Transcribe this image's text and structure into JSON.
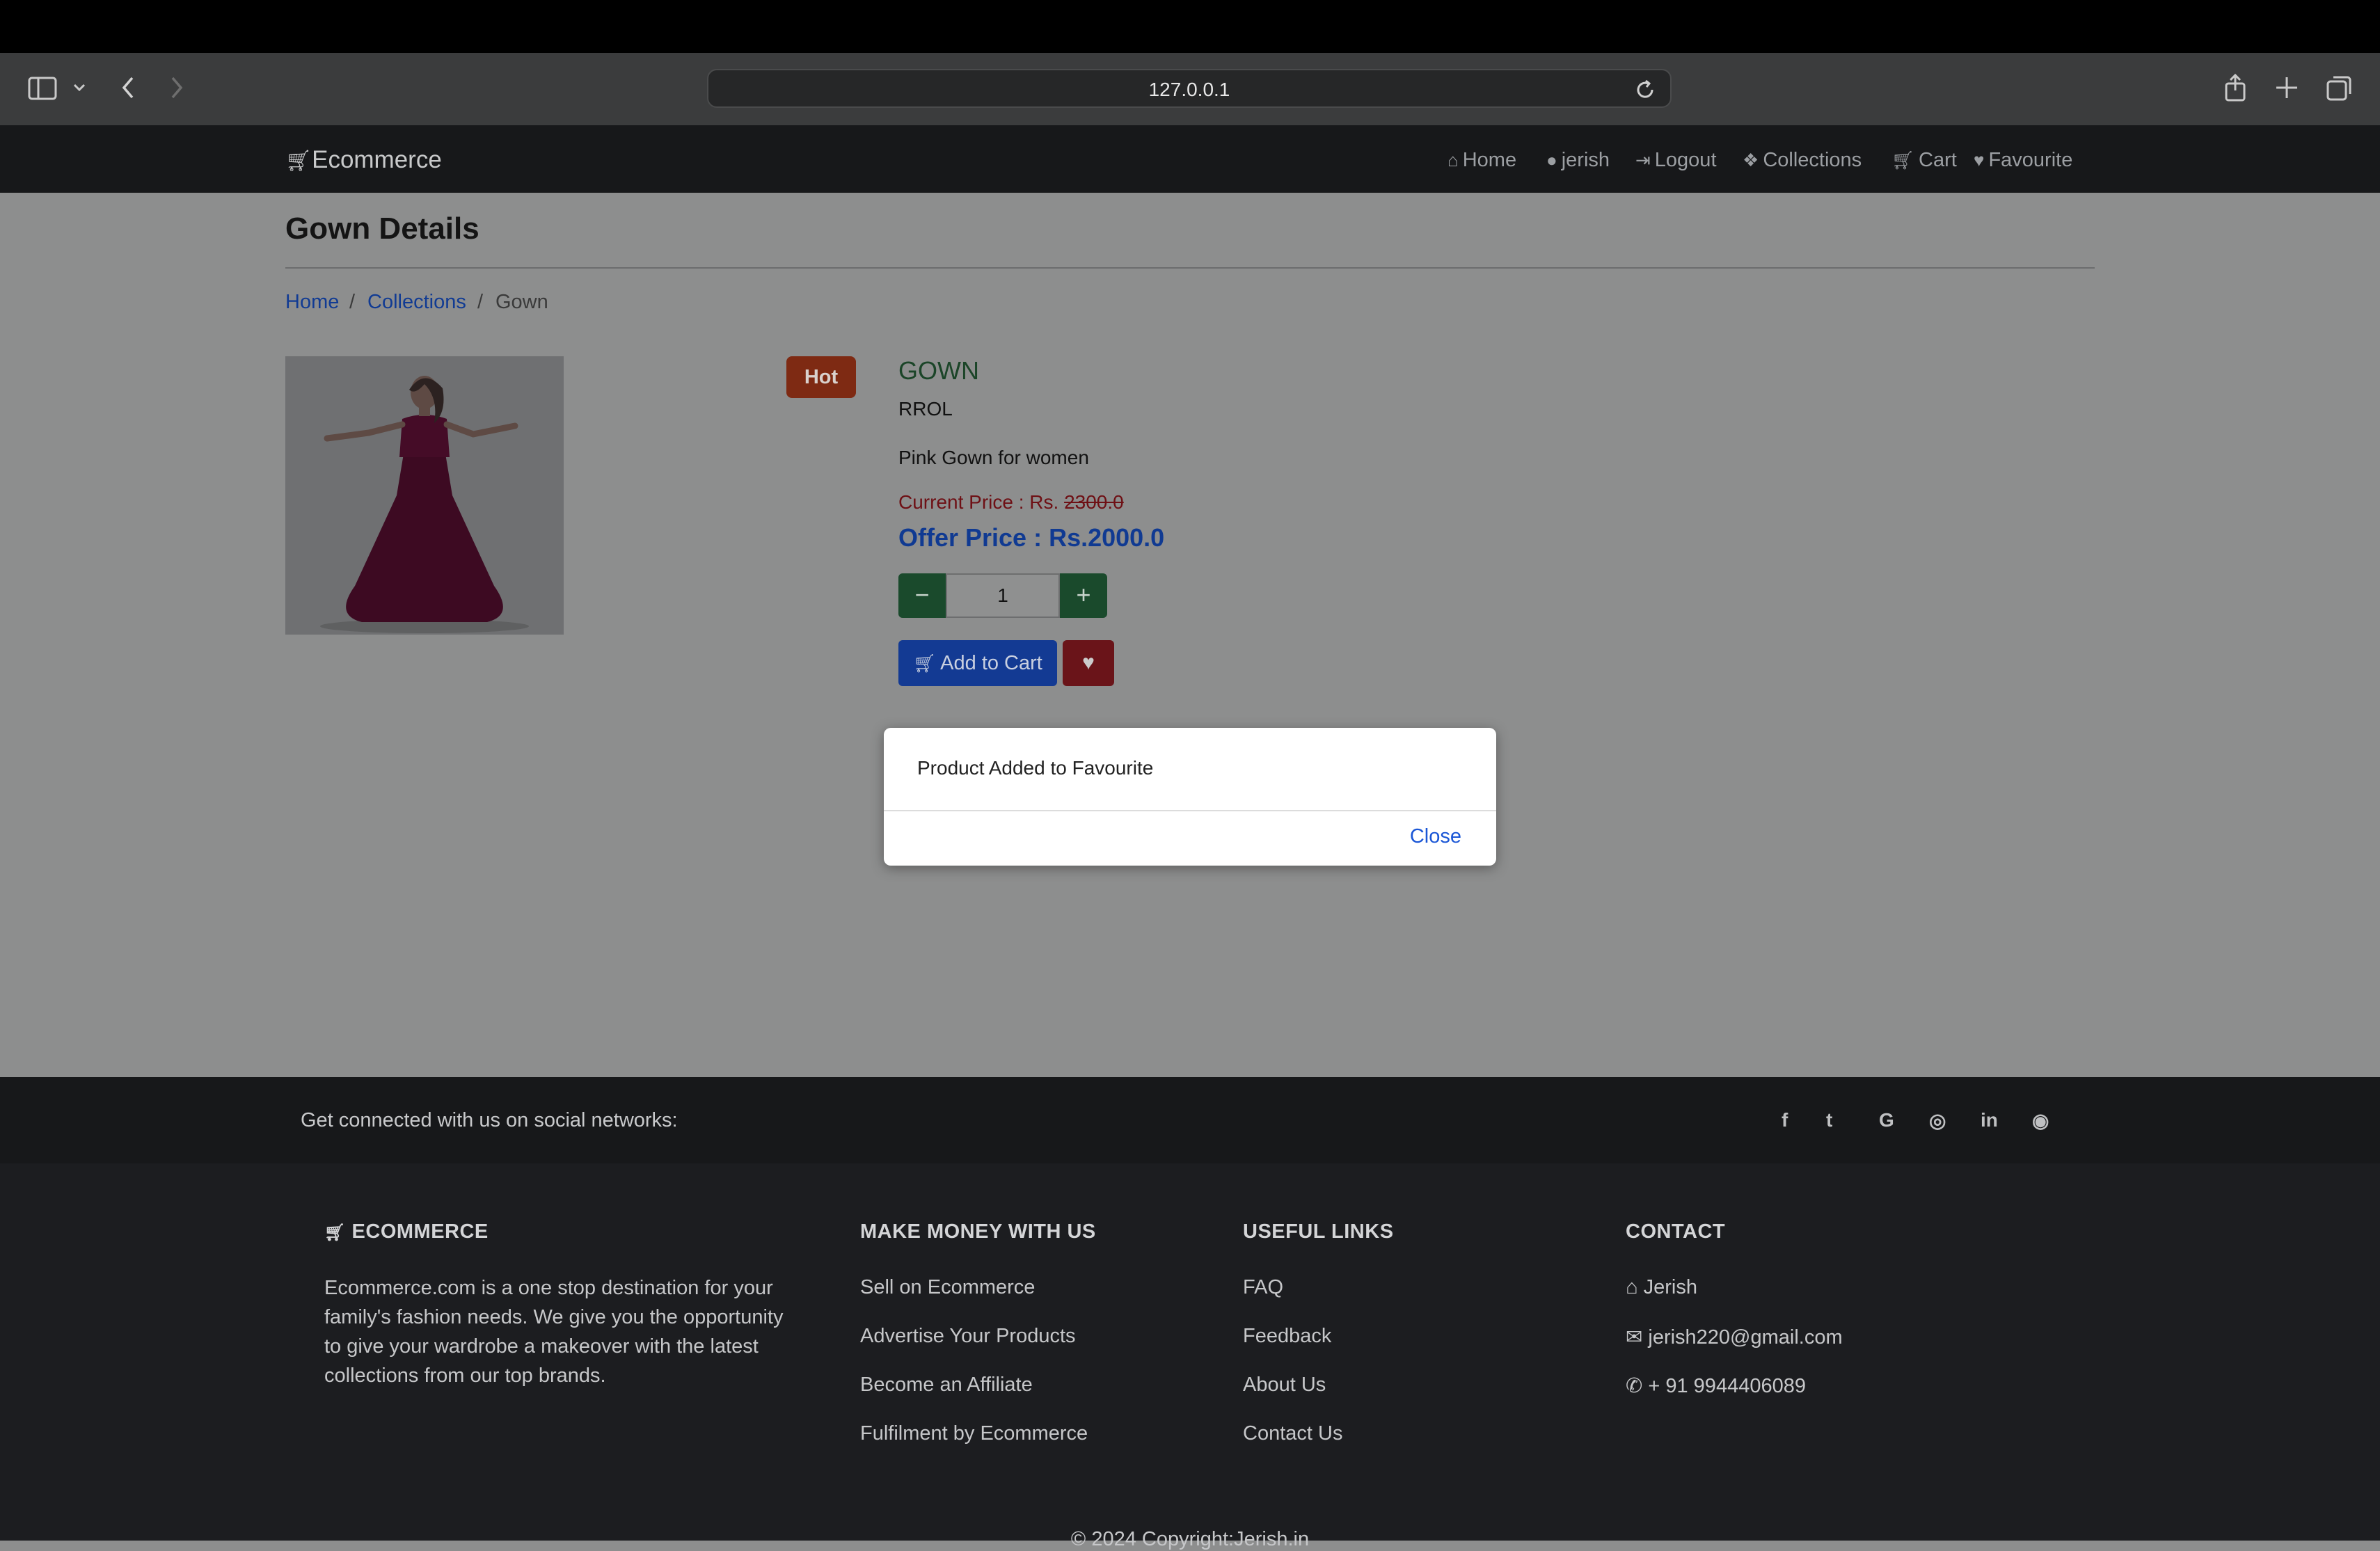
{
  "browser": {
    "url": "127.0.0.1",
    "icons": [
      "sidebar-icon",
      "chevron-down-icon",
      "back-icon",
      "forward-icon",
      "reload-icon",
      "share-icon",
      "new-tab-icon",
      "tabs-overview-icon"
    ]
  },
  "nav": {
    "brand": "Ecommerce",
    "items": [
      {
        "label": "Home",
        "icon": "home-icon"
      },
      {
        "label": "jerish",
        "icon": "user-icon"
      },
      {
        "label": "Logout",
        "icon": "logout-icon"
      },
      {
        "label": "Collections",
        "icon": "cubes-icon"
      },
      {
        "label": "Cart",
        "icon": "cart-icon"
      },
      {
        "label": "Favourite",
        "icon": "heart-icon"
      }
    ]
  },
  "page": {
    "title": "Gown Details",
    "breadcrumb": {
      "home": "Home",
      "sep": "/",
      "collections": "Collections",
      "current": "Gown"
    }
  },
  "product": {
    "badge": "Hot",
    "name": "GOWN",
    "brand": "RROL",
    "description": "Pink Gown for women",
    "current_price_label": "Current Price : Rs.",
    "current_price_value": "2300.0",
    "offer_price": "Offer Price : Rs.2000.0",
    "quantity": "1",
    "qty_minus": "−",
    "qty_plus": "+",
    "add_to_cart": "Add to Cart"
  },
  "modal": {
    "message": "Product Added to Favourite",
    "close_label": "Close"
  },
  "footer": {
    "social_text": "Get connected with us on social networks:",
    "social_icons": [
      {
        "name": "facebook-icon",
        "glyph": "f"
      },
      {
        "name": "twitter-icon",
        "glyph": "t"
      },
      {
        "name": "google-icon",
        "glyph": "G"
      },
      {
        "name": "instagram-icon",
        "glyph": "◎"
      },
      {
        "name": "linkedin-icon",
        "glyph": "in"
      },
      {
        "name": "github-icon",
        "glyph": "◉"
      }
    ],
    "brand_heading": "ECOMMERCE",
    "about": "Ecommerce.com is a one stop destination for your family's fashion needs. We give you the opportunity to give your wardrobe a makeover with the latest collections from our top brands.",
    "money_heading": "MAKE MONEY WITH US",
    "money_links": [
      "Sell on Ecommerce",
      "Advertise Your Products",
      "Become an Affiliate",
      "Fulfilment by Ecommerce"
    ],
    "useful_heading": "USEFUL LINKS",
    "useful_links": [
      "FAQ",
      "Feedback",
      "About Us",
      "Contact Us"
    ],
    "contact_heading": "CONTACT",
    "contact": {
      "name": "Jerish",
      "email": "jerish220@gmail.com",
      "phone": "+ 91 9944406089"
    },
    "copyright": "© 2024 Copyright:Jerish.in"
  }
}
